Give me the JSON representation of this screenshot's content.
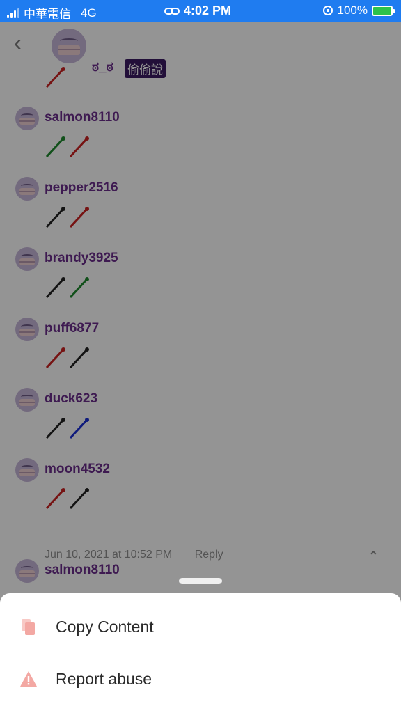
{
  "status_bar": {
    "carrier": "中華電信",
    "network": "4G",
    "time": "4:02 PM",
    "battery": "100%",
    "colors": {
      "background": "#1f7cf0"
    }
  },
  "header": {
    "username": "ಠ_ಠ",
    "badge": "偷偷說"
  },
  "comments": [
    {
      "username": "salmon8110",
      "horns": [
        "green",
        "red"
      ]
    },
    {
      "username": "pepper2516",
      "horns": [
        "black",
        "red"
      ]
    },
    {
      "username": "brandy3925",
      "horns": [
        "black",
        "green"
      ]
    },
    {
      "username": "puff6877",
      "horns": [
        "red",
        "black"
      ]
    },
    {
      "username": "duck623",
      "horns": [
        "black",
        "blue"
      ]
    },
    {
      "username": "moon4532",
      "horns": [
        "red",
        "black"
      ]
    }
  ],
  "meta": {
    "date": "Jun 10, 2021 at 10:52 PM",
    "reply_label": "Reply"
  },
  "next_comment": {
    "username": "salmon8110",
    "horns": [
      "red",
      "green"
    ]
  },
  "action_sheet": {
    "items": [
      {
        "label": "Copy Content",
        "icon": "copy-document-icon"
      },
      {
        "label": "Report abuse",
        "icon": "warning-triangle-icon"
      }
    ],
    "accent_color": "#f3a8a3"
  },
  "header_horn": "red"
}
